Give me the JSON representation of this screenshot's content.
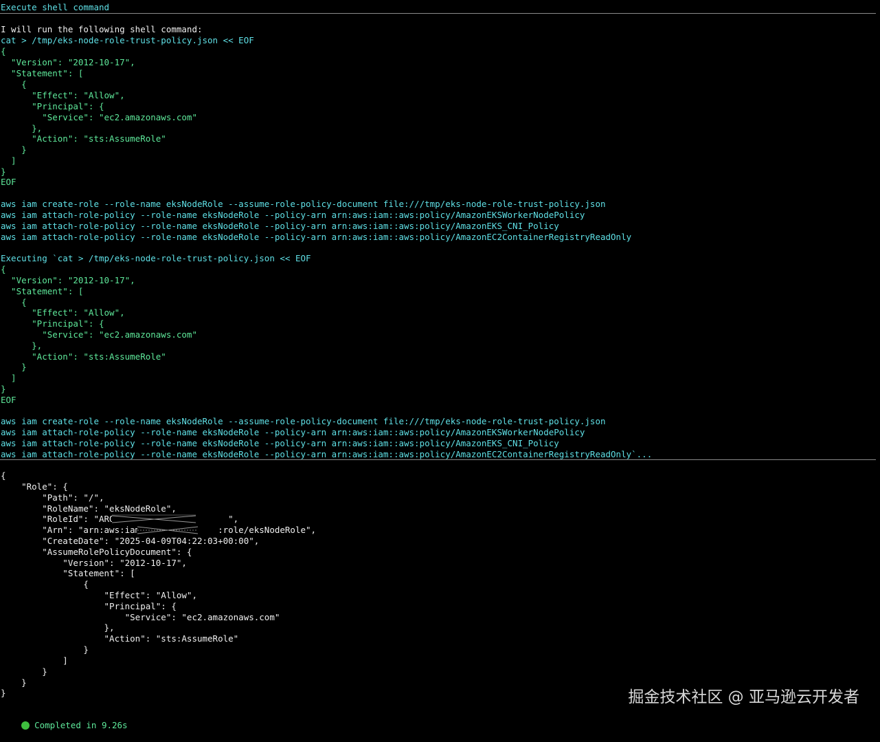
{
  "panel": {
    "title": "Execute shell command"
  },
  "intro": "I will run the following shell command:",
  "command_lines": [
    "cat > /tmp/eks-node-role-trust-policy.json << EOF",
    "{",
    "  \"Version\": \"2012-10-17\",",
    "  \"Statement\": [",
    "    {",
    "      \"Effect\": \"Allow\",",
    "      \"Principal\": {",
    "        \"Service\": \"ec2.amazonaws.com\"",
    "      },",
    "      \"Action\": \"sts:AssumeRole\"",
    "    }",
    "  ]",
    "}",
    "EOF",
    "",
    "aws iam create-role --role-name eksNodeRole --assume-role-policy-document file:///tmp/eks-node-role-trust-policy.json",
    "aws iam attach-role-policy --role-name eksNodeRole --policy-arn arn:aws:iam::aws:policy/AmazonEKSWorkerNodePolicy",
    "aws iam attach-role-policy --role-name eksNodeRole --policy-arn arn:aws:iam::aws:policy/AmazonEKS_CNI_Policy",
    "aws iam attach-role-policy --role-name eksNodeRole --policy-arn arn:aws:iam::aws:policy/AmazonEC2ContainerRegistryReadOnly"
  ],
  "executing_lines": [
    "Executing `cat > /tmp/eks-node-role-trust-policy.json << EOF",
    "{",
    "  \"Version\": \"2012-10-17\",",
    "  \"Statement\": [",
    "    {",
    "      \"Effect\": \"Allow\",",
    "      \"Principal\": {",
    "        \"Service\": \"ec2.amazonaws.com\"",
    "      },",
    "      \"Action\": \"sts:AssumeRole\"",
    "    }",
    "  ]",
    "}",
    "EOF",
    "",
    "aws iam create-role --role-name eksNodeRole --assume-role-policy-document file:///tmp/eks-node-role-trust-policy.json",
    "aws iam attach-role-policy --role-name eksNodeRole --policy-arn arn:aws:iam::aws:policy/AmazonEKSWorkerNodePolicy",
    "aws iam attach-role-policy --role-name eksNodeRole --policy-arn arn:aws:iam::aws:policy/AmazonEKS_CNI_Policy",
    "aws iam attach-role-policy --role-name eksNodeRole --policy-arn arn:aws:iam::aws:policy/AmazonEC2ContainerRegistryReadOnly`..."
  ],
  "output_lines": [
    "{",
    "    \"Role\": {",
    "        \"Path\": \"/\",",
    "        \"RoleName\": \"eksNodeRole\",",
    "        \"RoleId\": \"AROAI                    \",",
    "        \"Arn\": \"arn:aws:iam::             :role/eksNodeRole\",",
    "        \"CreateDate\": \"2025-04-09T04:22:03+00:00\",",
    "        \"AssumeRolePolicyDocument\": {",
    "            \"Version\": \"2012-10-17\",",
    "            \"Statement\": [",
    "                {",
    "                    \"Effect\": \"Allow\",",
    "                    \"Principal\": {",
    "                        \"Service\": \"ec2.amazonaws.com\"",
    "                    },",
    "                    \"Action\": \"sts:AssumeRole\"",
    "                }",
    "            ]",
    "        }",
    "    }",
    "}"
  ],
  "status": {
    "text": "Completed in 9.26s",
    "color": "#3fbf3f"
  },
  "watermark": "掘金技术社区 @ 亚马逊云开发者",
  "colors": {
    "background": "#000000",
    "command_cyan": "#5fe0e6",
    "command_green": "#5ee89a",
    "output_white": "#f0f0f0",
    "divider": "#8a8a8a"
  }
}
